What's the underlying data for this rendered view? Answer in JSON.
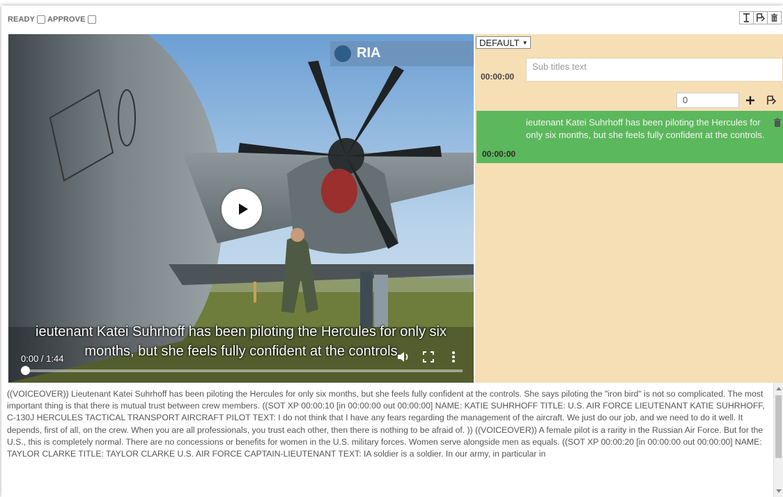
{
  "status_flags": {
    "ready_label": "READY",
    "approve_label": "APPROVE"
  },
  "toolbar": {
    "icons": [
      "text-cursor-icon",
      "save-icon",
      "trash-icon"
    ]
  },
  "video": {
    "watermark": "RIA",
    "caption_line1": "ieutenant Katei Suhrhoff has been piloting the Hercules for only six",
    "caption_line2": "months, but she feels fully confident at the controls",
    "time_display": "0:00 / 1:44",
    "progress_fraction": 0.0,
    "icons": [
      "play-icon",
      "volume-icon",
      "fullscreen-icon",
      "more-options-icon"
    ]
  },
  "editor": {
    "style_select_value": "DEFAULT",
    "entry_time": "00:00:00",
    "subtitle_placeholder": "Sub titles text",
    "offset_value": "0",
    "subtitles": [
      {
        "time": "00:00:00",
        "text": "ieutenant Katei Suhrhoff has been piloting the Hercules for only six months, but she feels fully confident at the controls."
      }
    ]
  },
  "transcript": {
    "text": "((VOICEOVER)) Lieutenant Katei Suhrhoff has been piloting the Hercules for only six months, but she feels fully confident at the controls. She says piloting the \"iron bird\" is not so complicated. The most important thing is that there is mutual trust between crew members. ((SOT XP 00:00:10 [in 00:00:00 out 00:00:00] NAME: KATIE SUHRHOFF TITLE: U.S. AIR FORCE LIEUTENANT KATIE SUHRHOFF, C-130J HERCULES TACTICAL TRANSPORT AIRCRAFT PILOT TEXT: I do not think that I have any fears regarding the management of the aircraft. We just do our job, and we need to do it well. It depends, first of all, on the crew. When you are all professionals, you trust each other, then there is nothing to be afraid of. )) ((VOICEOVER)) A female pilot is a rarity in the Russian Air Force. But for the U.S., this is completely normal. There are no concessions or benefits for women in the U.S. military forces. Women serve alongside men as equals. ((SOT XP 00:00:20 [in 00:00:00 out 00:00:00] NAME: TAYLOR CLARKE TITLE: TAYLOR CLARKE U.S. AIR FORCE CAPTAIN-LIEUTENANT TEXT: IA soldier is a soldier. In our army, in particular in"
  },
  "colors": {
    "panel_bg": "#f6deb5",
    "active_row_bg": "#5cb85c",
    "border": "#aaaaaa"
  }
}
